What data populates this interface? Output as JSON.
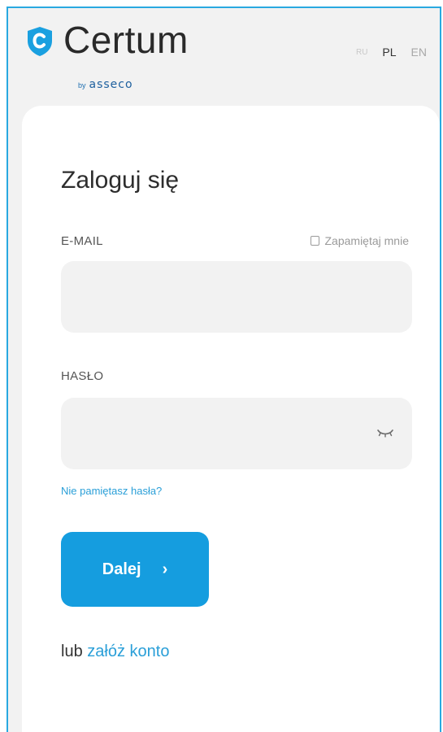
{
  "header": {
    "logo_text": "Certum",
    "logo_by": "by",
    "logo_company": "asseco",
    "languages": [
      "RU",
      "PL",
      "EN"
    ],
    "active_language": "PL"
  },
  "login": {
    "title": "Zaloguj się",
    "email_label": "E-MAIL",
    "remember_label": "Zapamiętaj mnie",
    "email_value": "",
    "password_label": "HASŁO",
    "password_value": "",
    "forgot_link": "Nie pamiętasz hasła?",
    "submit_label": "Dalej",
    "submit_arrow": "›",
    "alt_prefix": "lub",
    "alt_link": "załóż konto"
  },
  "colors": {
    "accent": "#159ddf",
    "link": "#2a9fd8",
    "frame_border": "#29a9e0",
    "background": "#f2f2f2"
  },
  "icons": {
    "logo": "shield-c-icon",
    "password_toggle": "eye-closed-icon"
  }
}
